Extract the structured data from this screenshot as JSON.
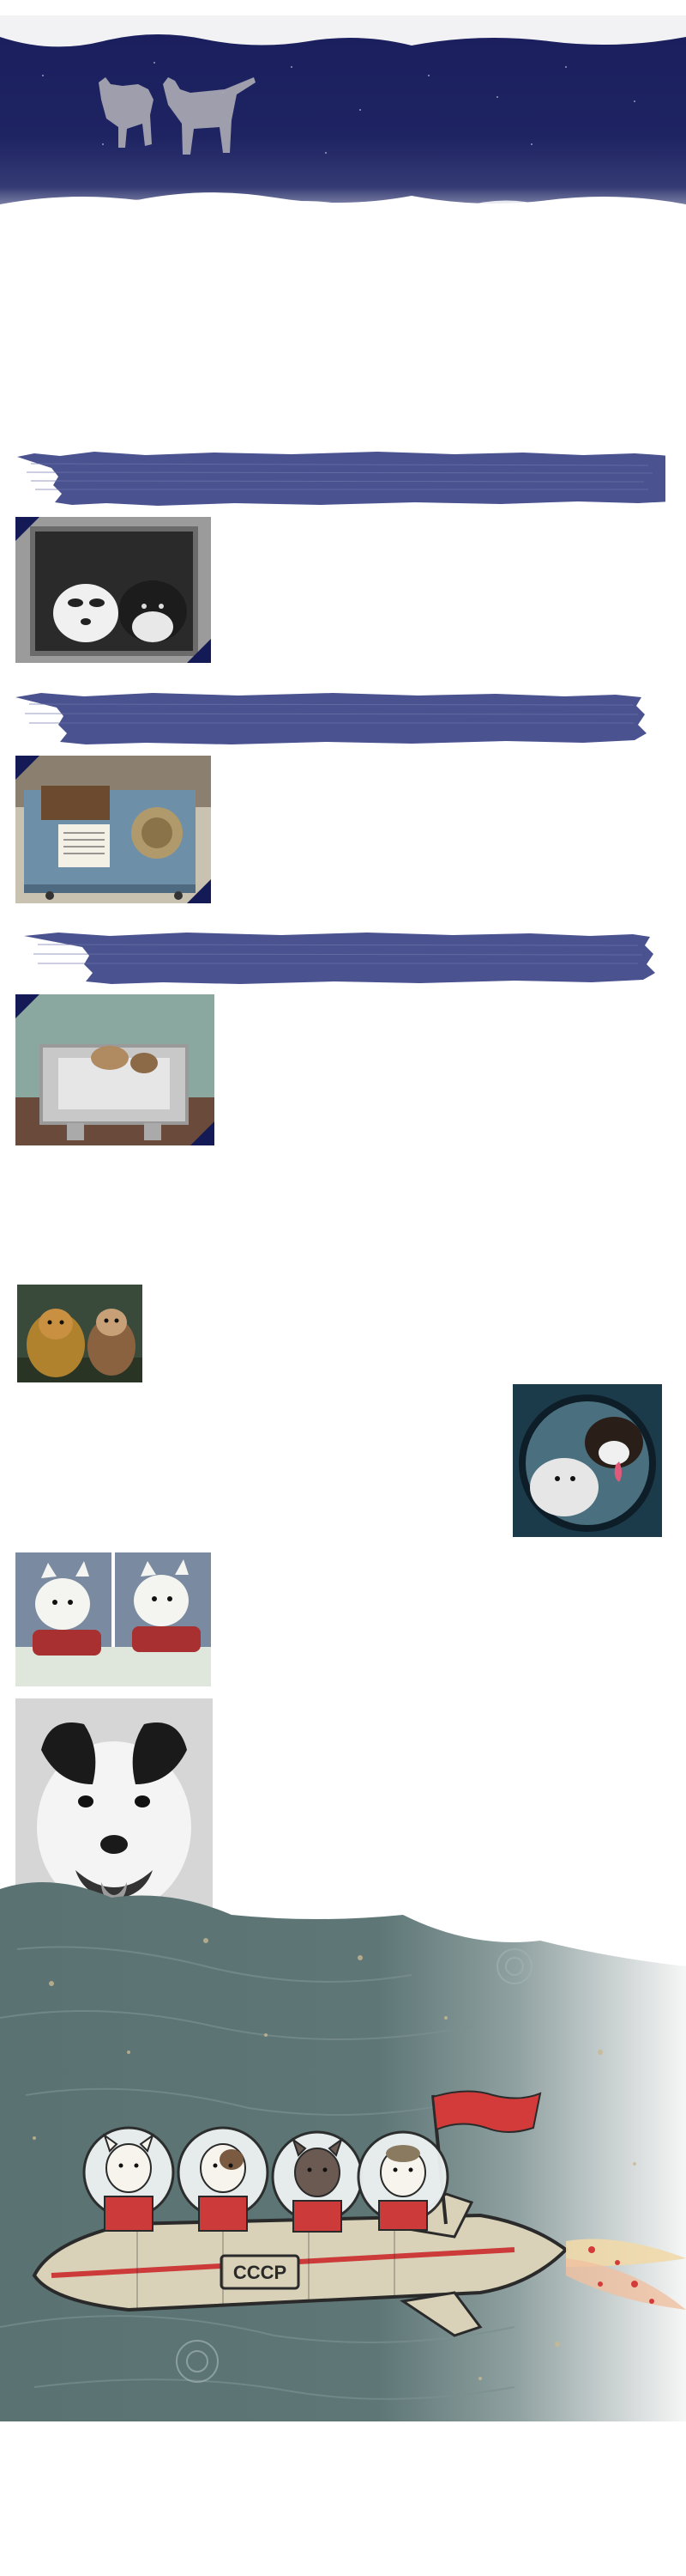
{
  "colors": {
    "banner_navy": "#1a1e5a",
    "brush_blue": "#4a5290",
    "corner_navy": "#141a55",
    "illustration_sea": "#5d7575",
    "rocket_cream": "#d9d2b8",
    "rocket_red": "#cc3a3a",
    "flag_red": "#d33b3b"
  },
  "header": {
    "icon": "two-dogs-silhouette-icon"
  },
  "sections": [
    {
      "name": "belka-strelka-capsule",
      "photo_kind": "bw-dogs-in-capsule"
    },
    {
      "name": "museum-capsule",
      "photo_kind": "museum-exhibit"
    },
    {
      "name": "training-capsule",
      "photo_kind": "training-device"
    }
  ],
  "gallery": [
    {
      "name": "two-dogs-sitting"
    },
    {
      "name": "dogs-in-porthole"
    },
    {
      "name": "dogs-in-red-suits"
    },
    {
      "name": "smiling-dog-portrait"
    }
  ],
  "illustration": {
    "rocket_label": "СССР",
    "dogs_count": 4
  }
}
